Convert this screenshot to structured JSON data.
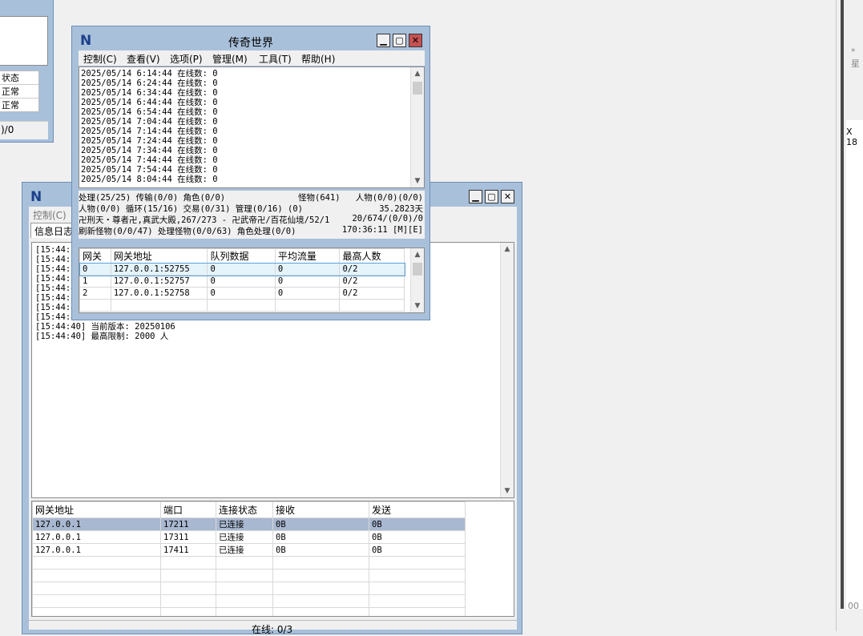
{
  "bg_window": {
    "status_partials": [
      "状态",
      "正常",
      "正常"
    ],
    "footer_partial": ")/0"
  },
  "right_edge": {
    "partial_1": "*星",
    "partial_2": "X 18",
    "partial_3": "00"
  },
  "server_window": {
    "menu": [
      "控制(C)"
    ],
    "tab_label": "信息日志",
    "log_prefix_lines": [
      "[15:44:3",
      "[15:44:3",
      "[15:44:3",
      "[15:44:3",
      "[15:44:4",
      "[15:44:4",
      "[15:44:4",
      "[15:44:4"
    ],
    "log_lines": [
      "[15:44:40] 当前版本: 20250106",
      "[15:44:40] 最高限制: 2000 人"
    ],
    "gateway_table": {
      "headers": [
        "网关地址",
        "端口",
        "连接状态",
        "接收",
        "发送"
      ],
      "rows": [
        [
          "127.0.0.1",
          "17211",
          "已连接",
          "0B",
          "0B"
        ],
        [
          "127.0.0.1",
          "17311",
          "已连接",
          "0B",
          "0B"
        ],
        [
          "127.0.0.1",
          "17411",
          "已连接",
          "0B",
          "0B"
        ]
      ]
    },
    "status_bar": "在线: 0/3"
  },
  "main_window": {
    "title": "传奇世界",
    "menu": [
      "控制(C)",
      "查看(V)",
      "选项(P)",
      "管理(M)",
      "工具(T)",
      "帮助(H)"
    ],
    "log_lines": [
      "2025/05/14 6:14:44 在线数: 0",
      "2025/05/14 6:24:44 在线数: 0",
      "2025/05/14 6:34:44 在线数: 0",
      "2025/05/14 6:44:44 在线数: 0",
      "2025/05/14 6:54:44 在线数: 0",
      "2025/05/14 7:04:44 在线数: 0",
      "2025/05/14 7:14:44 在线数: 0",
      "2025/05/14 7:24:44 在线数: 0",
      "2025/05/14 7:34:44 在线数: 0",
      "2025/05/14 7:44:44 在线数: 0",
      "2025/05/14 7:54:44 在线数: 0",
      "2025/05/14 8:04:44 在线数: 0"
    ],
    "status": {
      "l1_left": "处理(25/25) 传输(0/0) 角色(0/0)",
      "l1_mid": "怪物(641)",
      "l1_right": "人物(0/0)(0/0)",
      "l2_left": "人物(0/0) 循环(15/16) 交易(0/31) 管理(0/16) (0)",
      "l2_right": "35.2823天",
      "l3_left": "卍刑天・尊者卍,真武大殿,267/273 - 卍武帝卍/百花仙境/52/1",
      "l3_right": "20/674/(0/0)/0",
      "l4_left": "刷新怪物(0/0/47) 处理怪物(0/0/63) 角色处理(0/0)",
      "l4_right": "170:36:11 [M][E]"
    },
    "gateway_table": {
      "headers": [
        "网关",
        "网关地址",
        "队列数据",
        "平均流量",
        "最高人数"
      ],
      "rows": [
        [
          "0",
          "127.0.0.1:52755",
          "0",
          "0",
          "0/2"
        ],
        [
          "1",
          "127.0.0.1:52757",
          "0",
          "0",
          "0/2"
        ],
        [
          "2",
          "127.0.0.1:52758",
          "0",
          "0",
          "0/2"
        ]
      ]
    }
  }
}
